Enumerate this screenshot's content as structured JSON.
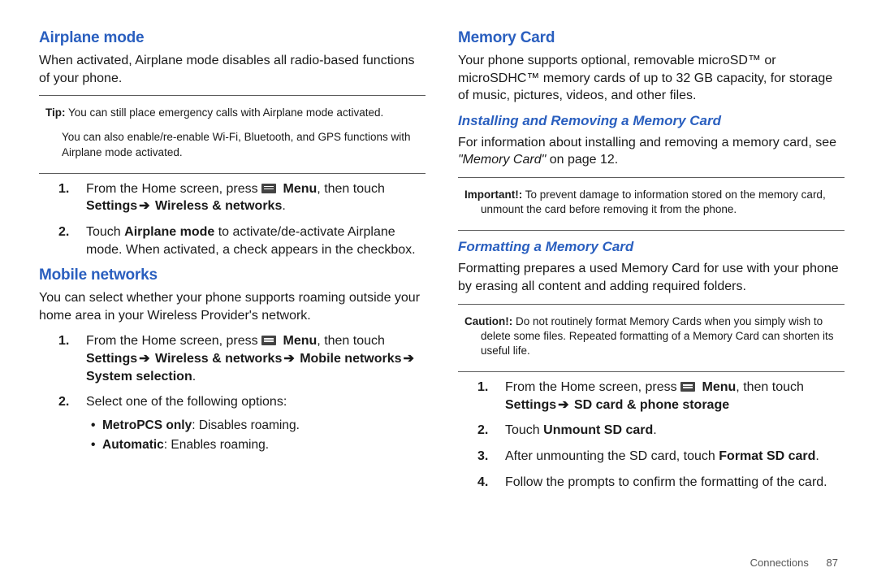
{
  "left": {
    "airplane": {
      "heading": "Airplane mode",
      "intro": "When activated, Airplane mode disables all radio-based functions of your phone.",
      "tip_lead": "Tip:",
      "tip_text": " You can still place emergency calls with Airplane mode activated.",
      "tip2": "You can also enable/re-enable Wi-Fi, Bluetooth, and GPS functions with Airplane mode activated.",
      "step1_pre": "From the Home screen, press ",
      "step1_menu": " Menu",
      "step1_post": ", then touch ",
      "step1_settings": "Settings",
      "step1_wn": " Wireless & networks",
      "step2_pre": "Touch ",
      "step2_bold": "Airplane mode",
      "step2_post": " to activate/de-activate Airplane mode. When activated, a check appears in the checkbox."
    },
    "mobile": {
      "heading": "Mobile networks",
      "intro": "You can select whether your phone supports roaming outside your home area in your Wireless Provider's network.",
      "step1_pre": "From the Home screen, press ",
      "step1_menu": " Menu",
      "step1_post": ", then touch ",
      "step1_settings": "Settings",
      "step1_wn": " Wireless & networks",
      "step1_mn": " Mobile networks",
      "step1_ss": " System selection",
      "step2": "Select one of the following options:",
      "bullet1_lead": "MetroPCS only",
      "bullet1_rest": ": Disables roaming.",
      "bullet2_lead": "Automatic",
      "bullet2_rest": ": Enables roaming."
    }
  },
  "right": {
    "memcard": {
      "heading": "Memory Card",
      "intro": "Your phone supports optional, removable microSD™ or microSDHC™ memory cards of up to 32 GB capacity, for storage of music, pictures, videos, and other files."
    },
    "install": {
      "heading": "Installing and Removing a Memory Card",
      "para_pre": "For information about installing and removing a memory card, see ",
      "para_ital": "\"Memory Card\"",
      "para_post": " on page 12.",
      "imp_lead": "Important!:",
      "imp_text": " To prevent damage to information stored on the memory card, unmount the card before removing it from the phone."
    },
    "format": {
      "heading": "Formatting a Memory Card",
      "intro": "Formatting prepares a used Memory Card for use with your phone by erasing all content and adding required folders.",
      "caution_lead": "Caution!:",
      "caution_text": " Do not routinely format Memory Cards when you simply wish to delete some files. Repeated formatting of a Memory Card can shorten its useful life.",
      "step1_pre": "From the Home screen, press ",
      "step1_menu": " Menu",
      "step1_post": ", then touch ",
      "step1_settings": "Settings",
      "step1_sd": " SD card & phone storage",
      "step2_pre": "Touch ",
      "step2_bold": "Unmount SD card",
      "step3_pre": "After unmounting the SD card, touch ",
      "step3_bold": "Format SD card",
      "step4": "Follow the prompts to confirm the formatting of the card."
    }
  },
  "footer": {
    "section": "Connections",
    "page": "87"
  },
  "arrow": "➔",
  "dot": "."
}
